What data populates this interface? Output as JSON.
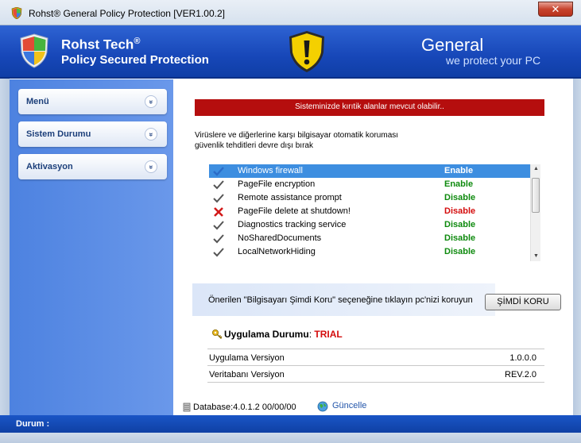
{
  "window": {
    "title": "Rohst® General Policy Protection [VER1.00.2]",
    "close_glyph": "✕"
  },
  "banner": {
    "brand_line1": "Rohst Tech",
    "brand_sup": "®",
    "brand_line2": "Policy Secured Protection",
    "general": "General",
    "tagline": "we protect your PC"
  },
  "sidebar": {
    "items": [
      {
        "label": "Menü"
      },
      {
        "label": "Sistem Durumu"
      },
      {
        "label": "Aktivasyon"
      }
    ],
    "chevron_glyph": "»"
  },
  "main": {
    "alert": "Sisteminizde kırıtik alanlar mevcut olabilir..",
    "desc_line1": "Virüslere ve diğerlerine karşı bilgisayar otomatik koruması",
    "desc_line2": "güvenlik tehditleri devre dışı bırak",
    "items": [
      {
        "name": "Windows firewall",
        "status": "Enable",
        "icon": "check-icon"
      },
      {
        "name": "PageFile encryption",
        "status": "Enable",
        "icon": "check-icon"
      },
      {
        "name": "Remote assistance prompt",
        "status": "Disable",
        "icon": "check-icon"
      },
      {
        "name": "PageFile delete at shutdown!",
        "status": "Disable",
        "icon": "cross-icon"
      },
      {
        "name": "Diagnostics tracking service",
        "status": "Disable",
        "icon": "check-icon"
      },
      {
        "name": "NoSharedDocuments",
        "status": "Disable",
        "icon": "check-icon"
      },
      {
        "name": "LocalNetworkHiding",
        "status": "Disable",
        "icon": "check-icon"
      }
    ],
    "recommend": "Önerilen \"Bilgisayarı Şimdi Koru\" seçeneğine tıklayın pc'nizi koruyun",
    "protect_button": "ŞİMDİ KORU",
    "app_status_label": "Uygulama Durumu",
    "app_status_colon": ": ",
    "app_status_value": "TRIAL",
    "info": [
      {
        "key": "Uygulama Versiyon",
        "value": "1.0.0.0"
      },
      {
        "key": "Veritabanı Versiyon",
        "value": "REV.2.0"
      }
    ],
    "database": "Database:4.0.1.2 00/00/00",
    "update_link": "Güncelle"
  },
  "statusbar": {
    "label": "Durum :"
  },
  "colors": {
    "enable": "#0e8a0e",
    "disable": "#0e8a0e",
    "disable_alert": "#d40d0d",
    "alert_bar": "#b50e0e",
    "banner": "#1747b8"
  }
}
